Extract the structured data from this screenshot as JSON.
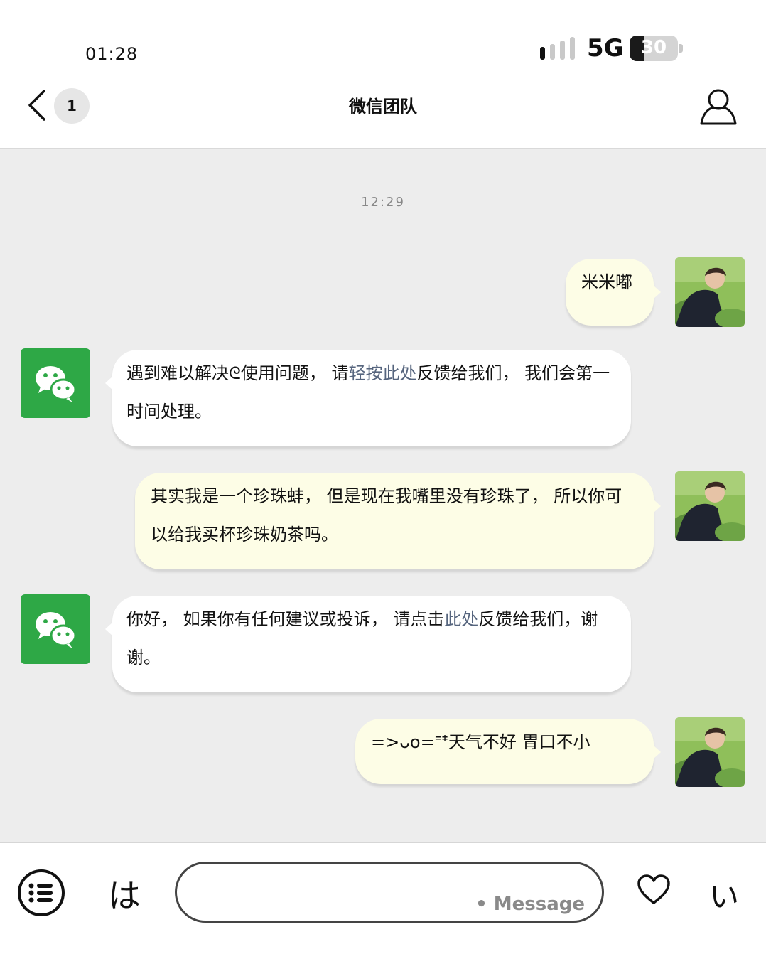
{
  "status": {
    "time": "01:28",
    "network": "5G",
    "battery": "30"
  },
  "nav": {
    "back_count": "1",
    "title": "微信团队"
  },
  "chat": {
    "timestamp": "12:29",
    "messages": [
      {
        "sender": "user",
        "text": "米米嘟"
      },
      {
        "sender": "wechat",
        "parts": [
          "遇到难以解决ᘓ使用问题， 请",
          "轻按此处",
          "反馈给我们， 我们会第一时间处理。"
        ]
      },
      {
        "sender": "user",
        "text": "其实我是一个珍珠蚌， 但是现在我嘴里没有珍珠了， 所以你可以给我买杯珍珠奶茶吗。"
      },
      {
        "sender": "wechat",
        "parts": [
          "你好， 如果你有任何建议或投诉， 请点击",
          "此处",
          "反馈给我们，谢谢。"
        ]
      },
      {
        "sender": "user",
        "text": "=>ᴗo=ᙾᙿ天气不好 胃口不小"
      }
    ]
  },
  "input_bar": {
    "left_key": "は",
    "placeholder": "• Message",
    "right_key": "い"
  },
  "icons": [
    "back-chevron-icon",
    "profile-icon",
    "wechat-logo-icon",
    "menu-list-icon",
    "heart-icon",
    "signal-icon",
    "battery-icon"
  ],
  "colors": {
    "wechat_green": "#2ea846",
    "link": "#56657e",
    "bubble_out": "#fdfde6",
    "chat_bg": "#ededed"
  }
}
